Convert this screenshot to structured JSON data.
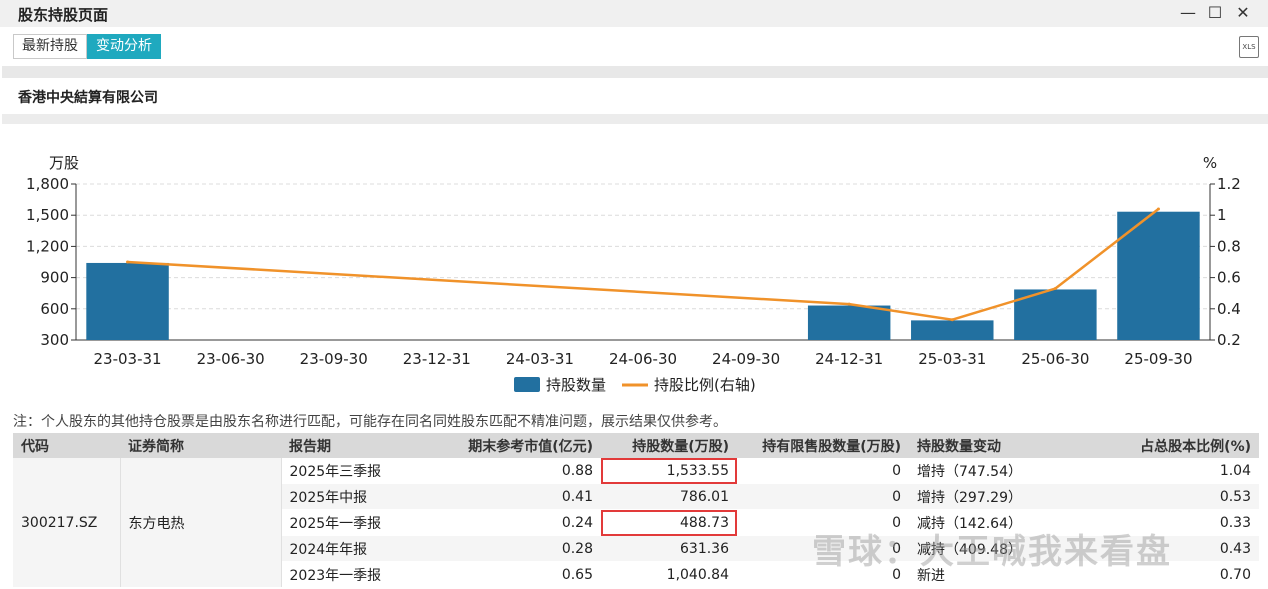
{
  "window": {
    "title": "股东持股页面",
    "minimize": "—",
    "maximize": "☐",
    "close": "✕"
  },
  "tabs": [
    {
      "label": "最新持股",
      "active": false
    },
    {
      "label": "变动分析",
      "active": true
    }
  ],
  "export_icon_label": "XLS",
  "company_name": "香港中央結算有限公司",
  "chart_data": {
    "type": "bar",
    "categories": [
      "23-03-31",
      "23-06-30",
      "23-09-30",
      "23-12-31",
      "24-03-31",
      "24-06-30",
      "24-09-30",
      "24-12-31",
      "25-03-31",
      "25-06-30",
      "25-09-30"
    ],
    "series": [
      {
        "name": "持股数量",
        "type": "bar",
        "axis": "left",
        "color": "#2270a0",
        "values": [
          1040.84,
          null,
          null,
          null,
          null,
          null,
          null,
          631.36,
          488.73,
          786.01,
          1533.55
        ]
      },
      {
        "name": "持股比例(右轴)",
        "type": "line",
        "axis": "right",
        "color": "#f0922a",
        "points": [
          {
            "x": "23-03-31",
            "y": 0.7
          },
          {
            "x": "24-12-31",
            "y": 0.43
          },
          {
            "x": "25-03-31",
            "y": 0.33
          },
          {
            "x": "25-06-30",
            "y": 0.53
          },
          {
            "x": "25-09-30",
            "y": 1.04
          }
        ]
      }
    ],
    "ylabel_left": "万股",
    "ylabel_right": "%",
    "ylim_left": [
      300,
      1800
    ],
    "yticks_left": [
      "300",
      "600",
      "900",
      "1,200",
      "1,500",
      "1,800"
    ],
    "ylim_right": [
      0.2,
      1.2
    ],
    "yticks_right": [
      "0.2",
      "0.4",
      "0.6",
      "0.8",
      "1",
      "1.2"
    ],
    "grid": true,
    "legend_position": "bottom-center"
  },
  "note": "注：个人股东的其他持仓股票是由股东名称进行匹配，可能存在同名同姓股东匹配不精准问题，展示结果仅供参考。",
  "table": {
    "headers": [
      "代码",
      "证券简称",
      "报告期",
      "期末参考市值(亿元)",
      "持股数量(万股)",
      "持有限售股数量(万股)",
      "持股数量变动",
      "占总股本比例(%)"
    ],
    "code": "300217.SZ",
    "name": "东方电热",
    "rows": [
      {
        "period": "2025年三季报",
        "value": "0.88",
        "shares": "1,533.55",
        "restricted": "0",
        "change": "增持（747.54）",
        "ratio": "1.04"
      },
      {
        "period": "2025年中报",
        "value": "0.41",
        "shares": "786.01",
        "restricted": "0",
        "change": "增持（297.29）",
        "ratio": "0.53"
      },
      {
        "period": "2025年一季报",
        "value": "0.24",
        "shares": "488.73",
        "restricted": "0",
        "change": "减持（142.64）",
        "ratio": "0.33"
      },
      {
        "period": "2024年年报",
        "value": "0.28",
        "shares": "631.36",
        "restricted": "0",
        "change": "减持（409.48）",
        "ratio": "0.43"
      },
      {
        "period": "2023年一季报",
        "value": "0.65",
        "shares": "1,040.84",
        "restricted": "0",
        "change": "新进",
        "ratio": "0.70"
      }
    ]
  },
  "watermark": "雪球：大王喊我来看盘"
}
